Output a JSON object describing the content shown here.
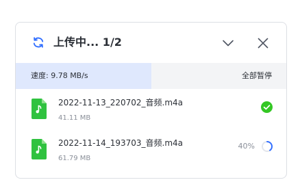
{
  "header": {
    "title": "上传中... 1/2",
    "icons": {
      "status": "sync-icon",
      "collapse": "chevron-down-icon",
      "close": "close-icon"
    }
  },
  "transfer": {
    "speed_text": "速度: 9.78 MB/s",
    "pause_all_label": "全部暂停",
    "overall_progress": 0.5
  },
  "files": [
    {
      "name": "2022-11-13_220702_音频.m4a",
      "size": "41.11 MB",
      "status": "complete",
      "icon": "audio-file-icon"
    },
    {
      "name": "2022-11-14_193703_音频.m4a",
      "size": "61.79 MB",
      "status": "uploading",
      "progress_text": "40%",
      "progress": 0.4,
      "icon": "audio-file-icon"
    }
  ],
  "colors": {
    "accent": "#3370ff",
    "success": "#34c724",
    "file_icon": "#2fc23f",
    "speed_fill": "#dfe8fd"
  }
}
